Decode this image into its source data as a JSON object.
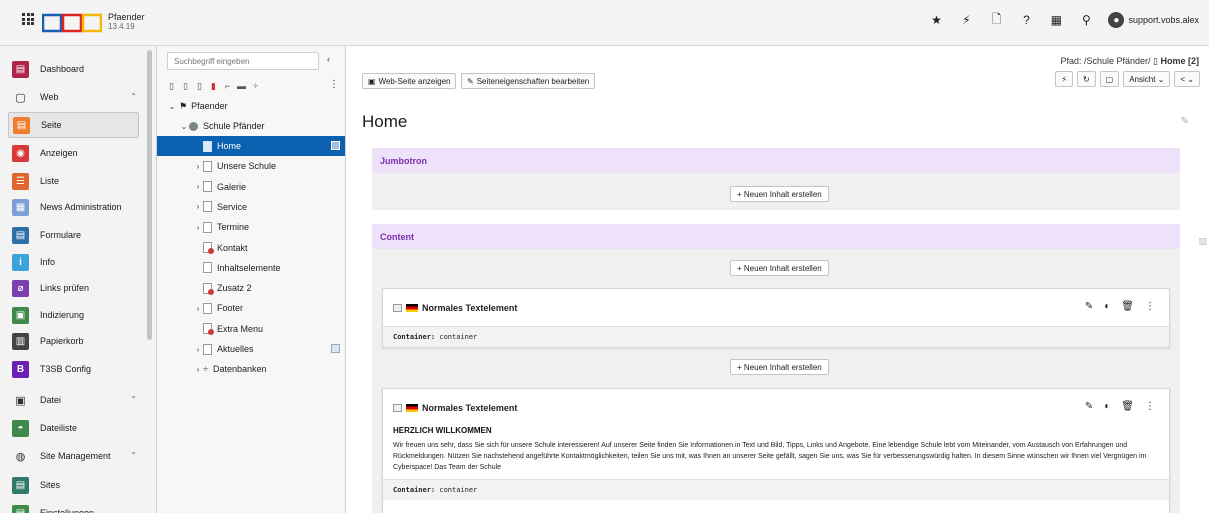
{
  "app": {
    "site_name": "Pfaender",
    "version": "13.4.19"
  },
  "topbar": {
    "user": "support.vobs.alex"
  },
  "left_nav": {
    "items": [
      {
        "label": "Dashboard",
        "icon": "dashboard-icon",
        "color": "#b0244a"
      },
      {
        "label": "Web",
        "icon": "web-icon",
        "color": "",
        "group": true
      },
      {
        "label": "Seite",
        "icon": "page-icon",
        "color": "#f07d2d",
        "active": true
      },
      {
        "label": "Anzeigen",
        "icon": "view-icon",
        "color": "#d83a3a"
      },
      {
        "label": "Liste",
        "icon": "list-icon",
        "color": "#e0662f"
      },
      {
        "label": "News Administration",
        "icon": "news-icon",
        "color": "#7c9fd5"
      },
      {
        "label": "Formulare",
        "icon": "forms-icon",
        "color": "#2f6fa8"
      },
      {
        "label": "Info",
        "icon": "info-icon",
        "color": "#3aa3d8"
      },
      {
        "label": "Links prüfen",
        "icon": "link-icon",
        "color": "#7d3fb0"
      },
      {
        "label": "Indizierung",
        "icon": "index-icon",
        "color": "#3f8a4a"
      },
      {
        "label": "Papierkorb",
        "icon": "trash-icon",
        "color": "#444444"
      },
      {
        "label": "T3SB Config",
        "icon": "bootstrap-icon",
        "color": "#6b1fb3"
      },
      {
        "label": "Datei",
        "icon": "file-icon",
        "color": "",
        "group": true
      },
      {
        "label": "Dateiliste",
        "icon": "filelist-icon",
        "color": "#3f8a4a"
      },
      {
        "label": "Site Management",
        "icon": "site-icon",
        "color": "",
        "group": true
      },
      {
        "label": "Sites",
        "icon": "sites-icon",
        "color": "#2f7a6a"
      },
      {
        "label": "Einstellungen",
        "icon": "settings-icon",
        "color": "#3f8a4a"
      }
    ]
  },
  "tree": {
    "search_placeholder": "Suchbegriff eingeben",
    "root": "Pfaender",
    "school": "Schule Pfänder",
    "nodes": [
      {
        "label": "Home",
        "selected": true
      },
      {
        "label": "Unsere Schule"
      },
      {
        "label": "Galerie"
      },
      {
        "label": "Service"
      },
      {
        "label": "Termine"
      },
      {
        "label": "Kontakt",
        "red": true
      },
      {
        "label": "Inhaltselemente"
      },
      {
        "label": "Zusatz 2",
        "red": true
      },
      {
        "label": "Footer"
      },
      {
        "label": "Extra Menu",
        "red": true
      },
      {
        "label": "Aktuelles"
      },
      {
        "label": "Datenbanken"
      }
    ]
  },
  "content": {
    "btn_view": "Web-Seite anzeigen",
    "btn_props": "Seiteneigenschaften bearbeiten",
    "path_label": "Pfad: /Schule Pfänder/",
    "path_current": "Home [2]",
    "view_label": "Ansicht",
    "page_title": "Home",
    "new_content": "+ Neuen Inhalt erstellen",
    "col_jumbotron": "Jumbotron",
    "col_content": "Content",
    "element_type": "Normales Textelement",
    "container_label": "Container:",
    "container_value": "container",
    "el2_heading": "HERZLICH WILLKOMMEN",
    "el2_text": "Wir freuen uns sehr, dass Sie sich für unsere Schule interessieren! Auf unserer Seite finden Sie Informationen in Text und Bild, Tipps, Links und Angebote. Eine lebendige Schule lebt vom Miteinander, vom Austausch von Erfahrungen und Rückmeldungen. Nützen Sie nachstehend angeführte Kontaktmöglichkeiten, teilen Sie uns mit, was Ihnen an unserer Seite gefällt, sagen Sie uns, was Sie für verbesserungswürdig halten. In diesem Sinne wünschen wir Ihnen viel Vergnügen im Cyberspace! Das Team der Schule"
  }
}
